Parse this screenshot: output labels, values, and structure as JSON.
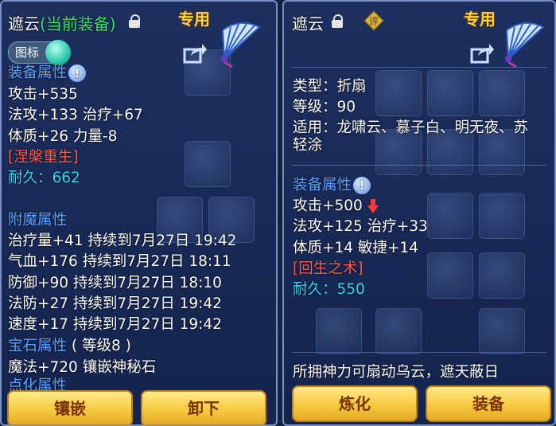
{
  "left_panel": {
    "title": "遮云",
    "title_suffix": "(当前装备)",
    "special_tag": "专用",
    "icon_toggle_label": "图标",
    "equip_attr_header": "装备属性",
    "base_attrs": [
      "攻击+535",
      "法攻+133 治疗+67",
      "体质+26 力量-8"
    ],
    "special_skill": "[涅槃重生]",
    "durability_label": "耐久：",
    "durability_value": "662",
    "enchant_header": "附魔属性",
    "enchant_attrs": [
      "治疗量+41 持续到7月27日 19:42",
      "气血+176 持续到7月27日 18:11",
      "防御+90 持续到7月27日 18:10",
      "法防+27 持续到7月27日 19:42",
      "速度+17 持续到7月27日 19:42"
    ],
    "gem_header": "宝石属性",
    "gem_level": "( 等级8 )",
    "gem_attr": "魔法+720 镶嵌神秘石",
    "partial_header": "点化属性",
    "buttons": [
      "镶嵌",
      "卸下"
    ]
  },
  "right_panel": {
    "title": "遮云",
    "appraise_label": "评",
    "special_tag": "专用",
    "type_line": "类型：折扇",
    "level_line": "等级：90",
    "fit_line": "适用：龙啸云、慕子白、明无夜、苏",
    "fit_line2": "轻涂",
    "equip_attr_header": "装备属性",
    "attack_line": "攻击+500",
    "attrs": [
      "法攻+125 治疗+33",
      "体质+14 敏捷+14"
    ],
    "special_skill": "[回生之术]",
    "durability_label": "耐久：",
    "durability_value": "550",
    "description": "所拥神力可扇动乌云，遮天蔽日",
    "buttons": [
      "炼化",
      "装备"
    ]
  },
  "icons": [
    "lock-icon",
    "share-icon",
    "fan-item-icon",
    "info-icon",
    "down-arrow-icon",
    "appraise-icon"
  ],
  "colors": {
    "title_green": "#37e06a",
    "header_blue": "#5aa3ff",
    "skill_red": "#ff5a4e",
    "durability_cyan": "#35d6f0",
    "special_gold": "#ffd23c",
    "button_gold": "#f6c93e"
  }
}
